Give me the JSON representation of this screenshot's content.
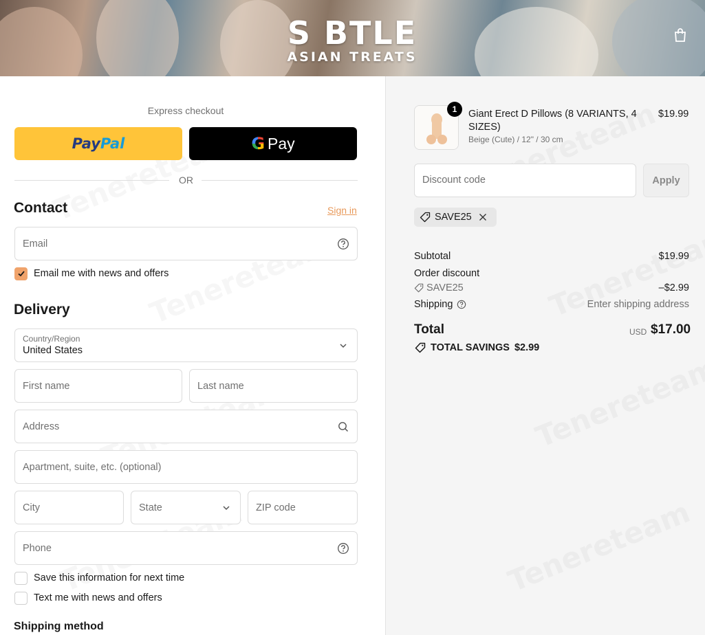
{
  "header": {
    "logo_line1": "S  BTLE",
    "logo_line2": "ASIAN TREATS",
    "cart_icon": "shopping-bag-icon"
  },
  "express_checkout": {
    "label": "Express checkout",
    "paypal_part1": "Pay",
    "paypal_part2": "Pal",
    "gpay_g": "G",
    "gpay_pay": "Pay",
    "divider": "OR",
    "paypal_color": "#ffc439"
  },
  "contact": {
    "title": "Contact",
    "sign_in": "Sign in",
    "email_placeholder": "Email",
    "news_checkbox": {
      "label": "Email me with news and offers",
      "checked": true
    }
  },
  "delivery": {
    "title": "Delivery",
    "country_label": "Country/Region",
    "country_value": "United States",
    "first_name": "First name",
    "last_name": "Last name",
    "address": "Address",
    "apartment": "Apartment, suite, etc. (optional)",
    "city": "City",
    "state": "State",
    "zip": "ZIP code",
    "phone": "Phone",
    "save_info": {
      "label": "Save this information for next time",
      "checked": false
    },
    "text_offers": {
      "label": "Text me with news and offers",
      "checked": false
    }
  },
  "shipping_method": {
    "title": "Shipping method"
  },
  "order": {
    "item": {
      "quantity": "1",
      "title": "Giant Erect D Pillows (8 VARIANTS, 4 SIZES)",
      "variant": "Beige (Cute) / 12\" / 30 cm",
      "price": "$19.99"
    },
    "discount_placeholder": "Discount code",
    "apply_label": "Apply",
    "applied_code": "SAVE25",
    "subtotal_label": "Subtotal",
    "subtotal_value": "$19.99",
    "order_discount_label": "Order discount",
    "discount_code": "SAVE25",
    "discount_value": "–$2.99",
    "shipping_label": "Shipping",
    "shipping_value": "Enter shipping address",
    "total_label": "Total",
    "currency": "USD",
    "total_value": "$17.00",
    "savings_label": "TOTAL SAVINGS",
    "savings_value": "$2.99"
  },
  "colors": {
    "accent": "#e8995a",
    "checkbox_checked": "#f0a36b",
    "summary_bg": "#f5f5f5"
  }
}
